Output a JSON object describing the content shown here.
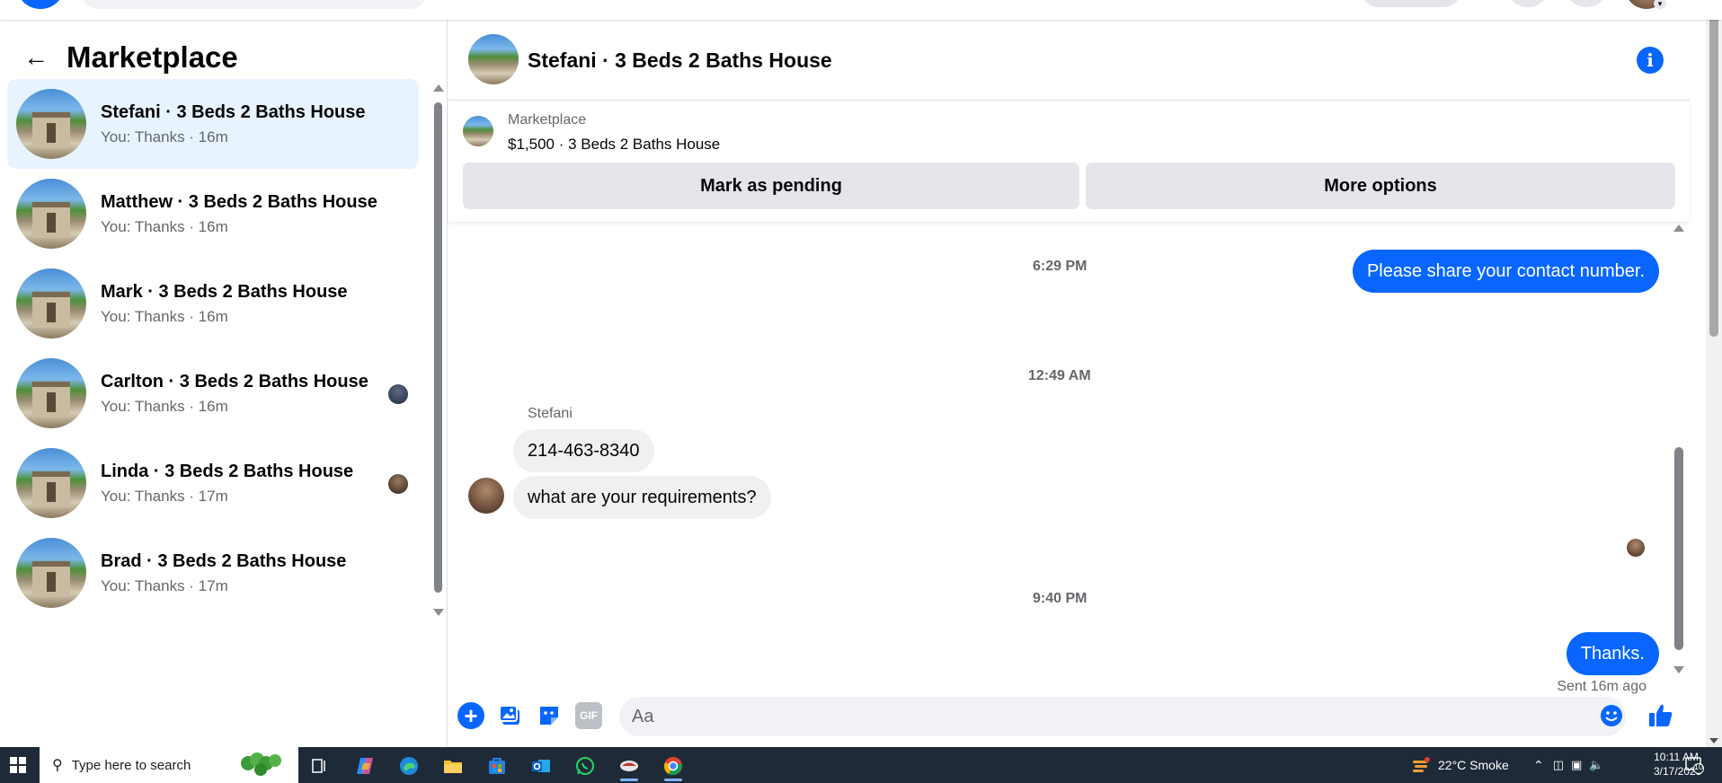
{
  "sidebar": {
    "title": "Marketplace",
    "conversations": [
      {
        "name": "Stefani · 3 Beds 2 Baths House",
        "preview": "You: Thanks · 16m",
        "active": true
      },
      {
        "name": "Matthew · 3 Beds 2 Baths House",
        "preview": "You: Thanks · 16m"
      },
      {
        "name": "Mark · 3 Beds 2 Baths House",
        "preview": "You: Thanks · 16m"
      },
      {
        "name": "Carlton · 3 Beds 2 Baths House",
        "preview": "You: Thanks · 16m"
      },
      {
        "name": "Linda · 3 Beds 2 Baths House",
        "preview": "You: Thanks · 17m"
      },
      {
        "name": "Brad · 3 Beds 2 Baths House",
        "preview": "You: Thanks · 17m"
      }
    ]
  },
  "chat": {
    "title": "Stefani · 3 Beds 2 Baths House",
    "info_icon": "i",
    "listing": {
      "label": "Marketplace",
      "price_title": "$1,500 · 3 Beds 2 Baths House",
      "pending_button": "Mark as pending",
      "more_button": "More options"
    },
    "messages": {
      "ts1": "6:29 PM",
      "out1": "Please share your contact number.",
      "ts2": "12:49 AM",
      "sender": "Stefani",
      "in1": "214-463-8340",
      "in2": "what are your requirements?",
      "ts3": "9:40 PM",
      "out2": "Thanks.",
      "status": "Sent 16m ago"
    },
    "composer": {
      "plus_icon": "+",
      "gif_label": "GIF",
      "placeholder": "Aa"
    }
  },
  "colors": {
    "accent": "#0866ff",
    "active_row": "#e7f3ff",
    "incoming_bubble": "#f0f0f0",
    "button_gray": "#e4e6eb",
    "taskbar": "#1f2a38"
  },
  "taskbar": {
    "search_placeholder": "Type here to search",
    "weather": "22°C  Smoke",
    "time": "10:11 AM",
    "date": "3/17/2025",
    "notification_count": "10",
    "apps": [
      "task-view-icon",
      "copilot-icon",
      "edge-icon",
      "file-explorer-icon",
      "store-icon",
      "outlook-icon",
      "whatsapp-icon",
      "app-icon",
      "chrome-icon"
    ]
  }
}
